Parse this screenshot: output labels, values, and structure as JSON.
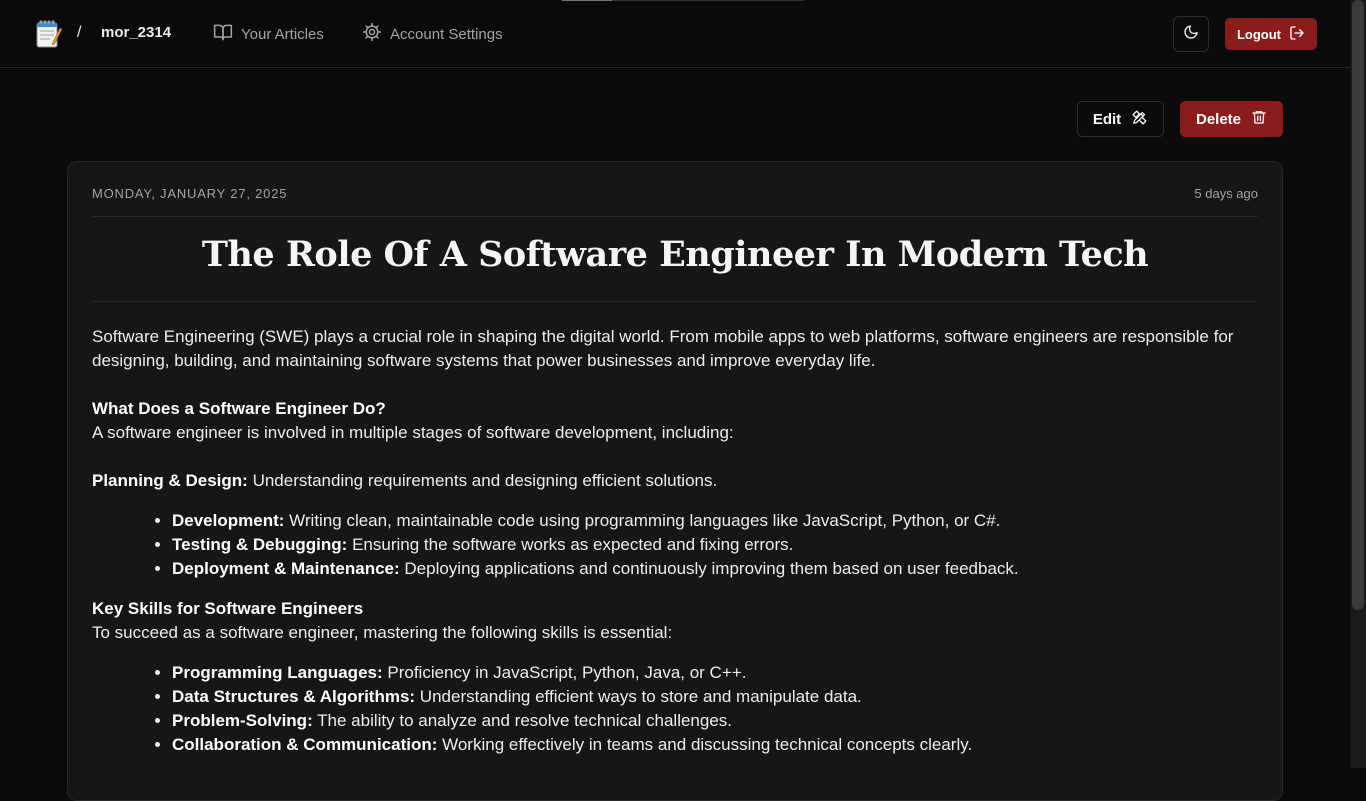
{
  "header": {
    "slash": "/",
    "username": "mor_2314",
    "nav": [
      {
        "label": "Your Articles",
        "icon": "book-icon"
      },
      {
        "label": "Account Settings",
        "icon": "gear-icon"
      }
    ],
    "logout_label": "Logout"
  },
  "actions": {
    "edit_label": "Edit",
    "delete_label": "Delete"
  },
  "article": {
    "date": "MONDAY, JANUARY 27, 2025",
    "relative_time": "5 days ago",
    "title": "The Role Of A Software Engineer In Modern Tech",
    "intro": "Software Engineering (SWE) plays a crucial role in shaping the digital world. From mobile apps to web platforms, software engineers are responsible for designing, building, and maintaining software systems that power businesses and improve everyday life.",
    "section1_heading": "What Does a Software Engineer Do?",
    "section1_text": "A software engineer is involved in multiple stages of software development, including:",
    "planning_term": "Planning & Design:",
    "planning_desc": " Understanding requirements and designing efficient solutions.",
    "list1": [
      {
        "term": "Development:",
        "desc": " Writing clean, maintainable code using programming languages like JavaScript, Python, or C#."
      },
      {
        "term": "Testing & Debugging:",
        "desc": " Ensuring the software works as expected and fixing errors."
      },
      {
        "term": "Deployment & Maintenance:",
        "desc": " Deploying applications and continuously improving them based on user feedback."
      }
    ],
    "section2_heading": "Key Skills for Software Engineers",
    "section2_text": "To succeed as a software engineer, mastering the following skills is essential:",
    "list2": [
      {
        "term": "Programming Languages:",
        "desc": " Proficiency in JavaScript, Python, Java, or C++."
      },
      {
        "term": "Data Structures & Algorithms:",
        "desc": " Understanding efficient ways to store and manipulate data."
      },
      {
        "term": "Problem-Solving:",
        "desc": " The ability to analyze and resolve technical challenges."
      },
      {
        "term": "Collaboration & Communication:",
        "desc": " Working effectively in teams and discussing technical concepts clearly."
      }
    ]
  },
  "colors": {
    "background": "#0a0a0a",
    "card": "#171515",
    "danger": "#8b1c1c",
    "muted_text": "#a3a3a3"
  }
}
